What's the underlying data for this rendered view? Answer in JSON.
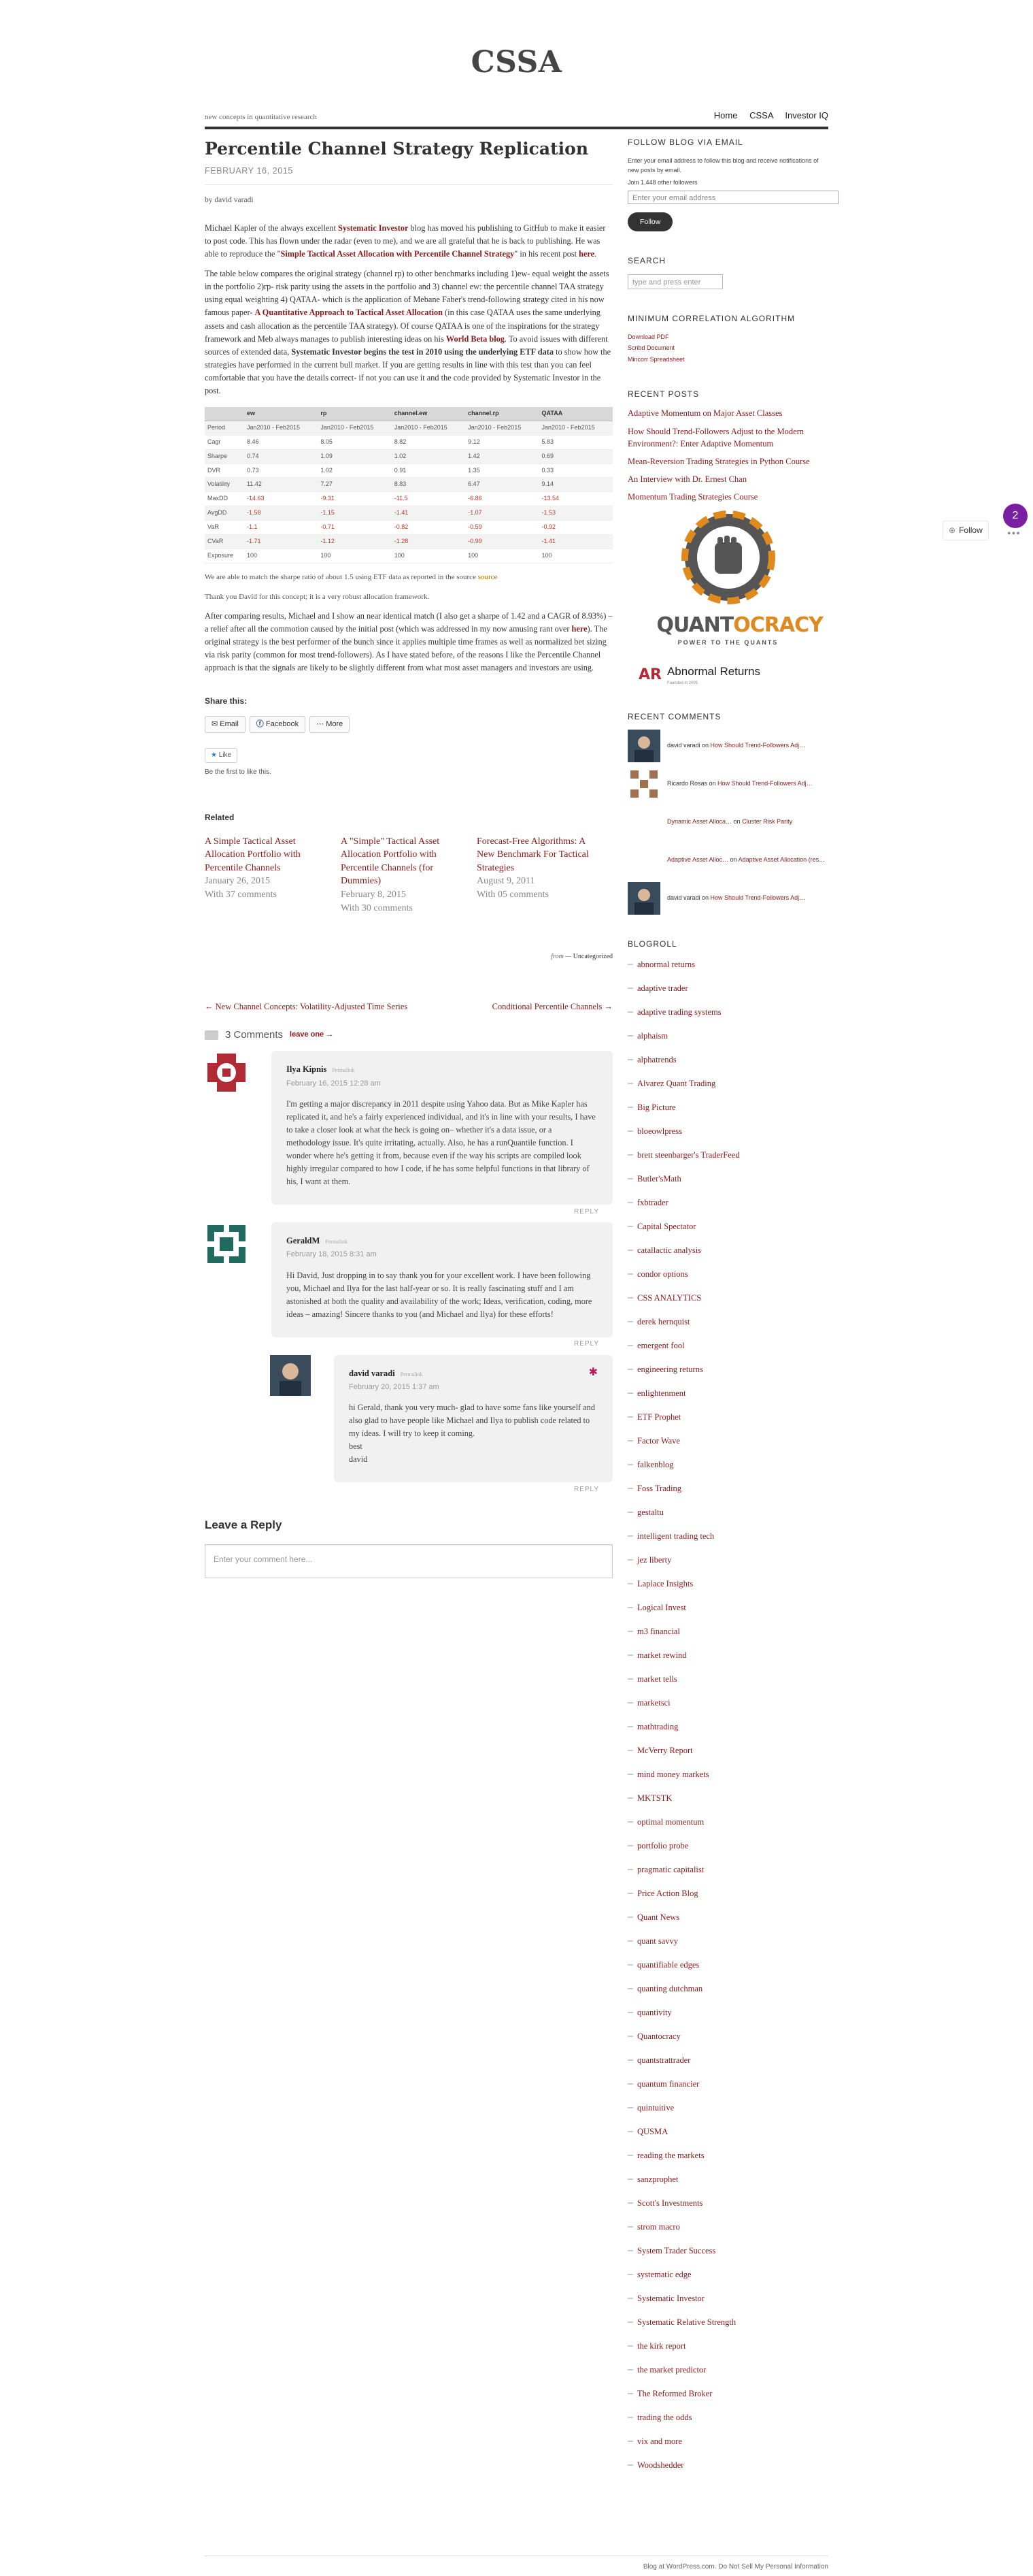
{
  "site": {
    "title": "CSSA",
    "tagline": "new concepts in quantitative research"
  },
  "nav": [
    "Home",
    "CSSA",
    "Investor IQ"
  ],
  "post": {
    "title": "Percentile Channel Strategy Replication",
    "date": "FEBRUARY 16, 2015",
    "byline": "by david varadi",
    "p1_a": "Michael Kapler of the always excellent ",
    "p1_link1": "Systematic Investor",
    "p1_b": " blog has moved his publishing to GitHub to make it easier to post code. This has flown under the radar (even to me), and we are all grateful that he is back to publishing. He was able to reproduce the \"",
    "p1_link2": "Simple Tactical Asset Allocation with Percentile Channel Strategy",
    "p1_c": "\" in his recent post ",
    "p1_link3": "here",
    "p1_d": ".",
    "p2_a": "The table below compares the original strategy (channel rp) to other benchmarks including 1)ew- equal weight the assets in the portfolio 2)rp- risk parity using the assets in the portfolio and 3) channel ew: the percentile channel TAA strategy using equal weighting 4) QATAA- which is the application of Mebane Faber's trend-following strategy cited in his now famous paper- ",
    "p2_link1": "A Quantitative Approach to Tactical Asset Allocation",
    "p2_b": " (in this case QATAA uses the same underlying assets and cash allocation as the percentile TAA strategy). Of course QATAA is one of the inspirations for the strategy framework and Meb always manages to publish interesting ideas on his ",
    "p2_link2": "World Beta blog",
    "p2_c": ". To avoid issues with different sources of extended data, ",
    "p2_bold": "Systematic Investor begins the test in 2010 using the underlying ETF data",
    "p2_d": " to show how the strategies have performed in the current bull market. If you are getting results in line with this test than you can feel comfortable that you have the details correct- if not you can use it and the code provided by Systematic Investor in the post.",
    "table": {
      "headers": [
        "",
        "ew",
        "rp",
        "channel.ew",
        "channel.rp",
        "QATAA"
      ],
      "rows": [
        [
          "Period",
          "Jan2010 - Feb2015",
          "Jan2010 - Feb2015",
          "Jan2010 - Feb2015",
          "Jan2010 - Feb2015",
          "Jan2010 - Feb2015"
        ],
        [
          "Cagr",
          "8.46",
          "8.05",
          "8.82",
          "9.12",
          "5.83"
        ],
        [
          "Sharpe",
          "0.74",
          "1.09",
          "1.02",
          "1.42",
          "0.69"
        ],
        [
          "DVR",
          "0.73",
          "1.02",
          "0.91",
          "1.35",
          "0.33"
        ],
        [
          "Volatility",
          "11.42",
          "7.27",
          "8.83",
          "6.47",
          "9.14"
        ],
        [
          "MaxDD",
          "-14.63",
          "-9.31",
          "-11.5",
          "-6.86",
          "-13.54"
        ],
        [
          "AvgDD",
          "-1.58",
          "-1.15",
          "-1.41",
          "-1.07",
          "-1.53"
        ],
        [
          "VaR",
          "-1.1",
          "-0.71",
          "-0.82",
          "-0.59",
          "-0.92"
        ],
        [
          "CVaR",
          "-1.71",
          "-1.12",
          "-1.28",
          "-0.99",
          "-1.41"
        ],
        [
          "Exposure",
          "100",
          "100",
          "100",
          "100",
          "100"
        ]
      ]
    },
    "note1_a": "We are able to match the sharpe ratio of about 1.5 using ETF data as reported in the source ",
    "note1_link": "source",
    "note2": "Thank you David for this concept; it is a very robust allocation framework.",
    "p3_a": "After comparing results, Michael and I show an near identical match (I also get a sharpe of 1.42 and a CAGR of 8.93%) – a relief after all the commotion caused by the initial post (which was addressed in my now amusing rant over ",
    "p3_link": "here",
    "p3_b": "). The original strategy is the best performer of the bunch since it applies multiple time frames as well as normalized bet sizing via risk parity (common for most trend-followers). As I have stated before, of the reasons I like the Percentile Channel approach is that the signals are likely to be slightly different from what most asset managers and investors are using.",
    "share_title": "Share this:",
    "share": [
      "Email",
      "Facebook",
      "More"
    ],
    "like": "Like",
    "like_note": "Be the first to like this.",
    "related_title": "Related",
    "related": [
      {
        "title": "A Simple Tactical Asset Allocation Portfolio with Percentile Channels",
        "date": "January 26, 2015",
        "comments": "With 37 comments"
      },
      {
        "title": "A \"Simple\" Tactical Asset Allocation Portfolio with Percentile Channels (for Dummies)",
        "date": "February 8, 2015",
        "comments": "With 30 comments"
      },
      {
        "title": "Forecast-Free Algorithms: A New Benchmark For Tactical Strategies",
        "date": "August 9, 2011",
        "comments": "With 05 comments"
      }
    ],
    "meta_prefix": "from —",
    "meta_cat": "Uncategorized",
    "prev": "← New Channel Concepts: Volatility-Adjusted Time Series",
    "next": "Conditional Percentile Channels →"
  },
  "comments": {
    "count": "3 Comments",
    "leave_link": "leave one →",
    "items": [
      {
        "name": "Ilya Kipnis",
        "perma": "Permalink",
        "when": "February 16, 2015 12:28 am",
        "text": "I'm getting a major discrepancy in 2011 despite using Yahoo data. But as Mike Kapler has replicated it, and he's a fairly experienced individual, and it's in line with your results, I have to take a closer look at what the heck is going on– whether it's a data issue, or a methodology issue. It's quite irritating, actually. Also, he has a runQuantile function. I wonder where he's getting it from, because even if the way his scripts are compiled look highly irregular compared to how I code, if he has some helpful functions in that library of his, I want at them.",
        "reply": "REPLY"
      },
      {
        "name": "GeraldM",
        "perma": "Permalink",
        "when": "February 18, 2015 8:31 am",
        "text": "Hi David, Just dropping in to say thank you for your excellent work. I have been following you, Michael and Ilya for the last half-year or so. It is really fascinating stuff and I am astonished at both the quality and availability of the work; Ideas, verification, coding, more ideas – amazing! Sincere thanks to you (and Michael and Ilya) for these efforts!",
        "reply": "REPLY"
      },
      {
        "name": "david varadi",
        "perma": "Permalink",
        "when": "February 20, 2015 1:37 am",
        "text": "hi Gerald, thank you very much- glad to have some fans like yourself and also glad to have people like Michael and Ilya to publish code related to my ideas. I will try to keep it coming.\nbest\ndavid",
        "reply": "REPLY"
      }
    ],
    "leave_title": "Leave a Reply",
    "placeholder": "Enter your comment here..."
  },
  "sidebar": {
    "follow_title": "FOLLOW BLOG VIA EMAIL",
    "follow_desc": "Enter your email address to follow this blog and receive notifications of new posts by email.",
    "follow_count": "Join 1,448 other followers",
    "email_placeholder": "Enter your email address",
    "follow_button": "Follow",
    "search_title": "SEARCH",
    "search_placeholder": "type and press enter",
    "min_title": "MINIMUM CORRELATION ALGORITHM",
    "min_links": [
      "Download PDF",
      "Scribd Document",
      "Mincorr Spreadsheet"
    ],
    "recent_title": "RECENT POSTS",
    "recent": [
      "Adaptive Momentum on Major Asset Classes",
      "How Should Trend-Followers Adjust to the Modern Environment?: Enter Adaptive Momentum",
      "Mean-Reversion Trading Strategies in Python Course",
      "An Interview with Dr. Ernest Chan",
      "Momentum Trading Strategies Course"
    ],
    "quant_a": "QUANT",
    "quant_b": "OCRACY",
    "quant_sub": "POWER TO THE QUANTS",
    "ar_logo": "AR",
    "ar_name": "Abnormal Returns",
    "ar_sub": "Founded in 2005",
    "rc_title": "RECENT COMMENTS",
    "rc": [
      {
        "who": "david varadi",
        "on": " on ",
        "post": "How Should Trend-Followers Adj…"
      },
      {
        "who": "Ricardo Rosas",
        "on": " on ",
        "post": "How Should Trend-Followers Adj…"
      },
      {
        "who": "Dynamic Asset Alloca…",
        "on": " on ",
        "post": "Cluster Risk Parity"
      },
      {
        "who": "Adaptive Asset Alloc…",
        "on": " on ",
        "post": "Adaptive Asset Allocation (res…"
      },
      {
        "who": "david varadi",
        "on": " on ",
        "post": "How Should Trend-Followers Adj…"
      }
    ],
    "blogroll_title": "BLOGROLL",
    "blogroll": [
      "abnormal returns",
      "adaptive trader",
      "adaptive trading systems",
      "alphaism",
      "alphatrends",
      "Alvarez Quant Trading",
      "Big Picture",
      "bloeowlpress",
      "brett steenbarger's TraderFeed",
      "Butler'sMath",
      "fxbtrader",
      "Capital Spectator",
      "catallactic analysis",
      "condor options",
      "CSS ANALYTICS",
      "derek hernquist",
      "emergent fool",
      "engineering returns",
      "enlightenment",
      "ETF Prophet",
      "Factor Wave",
      "falkenblog",
      "Foss Trading",
      "gestaltu",
      "intelligent trading tech",
      "jez liberty",
      "Laplace Insights",
      "Logical Invest",
      "m3 financial",
      "market rewind",
      "market tells",
      "marketsci",
      "mathtrading",
      "McVerry Report",
      "mind money markets",
      "MKTSTK",
      "optimal momentum",
      "portfolio probe",
      "pragmatic capitalist",
      "Price Action Blog",
      "Quant News",
      "quant savvy",
      "quantifiable edges",
      "quanting dutchman",
      "quantivity",
      "Quantocracy",
      "quantstrattrader",
      "quantum financier",
      "quintuitive",
      "QUSMA",
      "reading the markets",
      "sanzprophet",
      "Scott's Investments",
      "strom macro",
      "System Trader Success",
      "systematic edge",
      "Systematic Investor",
      "Systematic Relative Strength",
      "the kirk report",
      "the market predictor",
      "The Reformed Broker",
      "trading the odds",
      "vix and more",
      "Woodshedder"
    ]
  },
  "float": {
    "follow": "Follow",
    "badge": "2"
  },
  "footer": "Blog at WordPress.com.   Do Not Sell My Personal Information",
  "colors": {
    "link": "#8c1a1a",
    "accent_badge": "#7b1fa2",
    "negative": "#c0392b"
  }
}
